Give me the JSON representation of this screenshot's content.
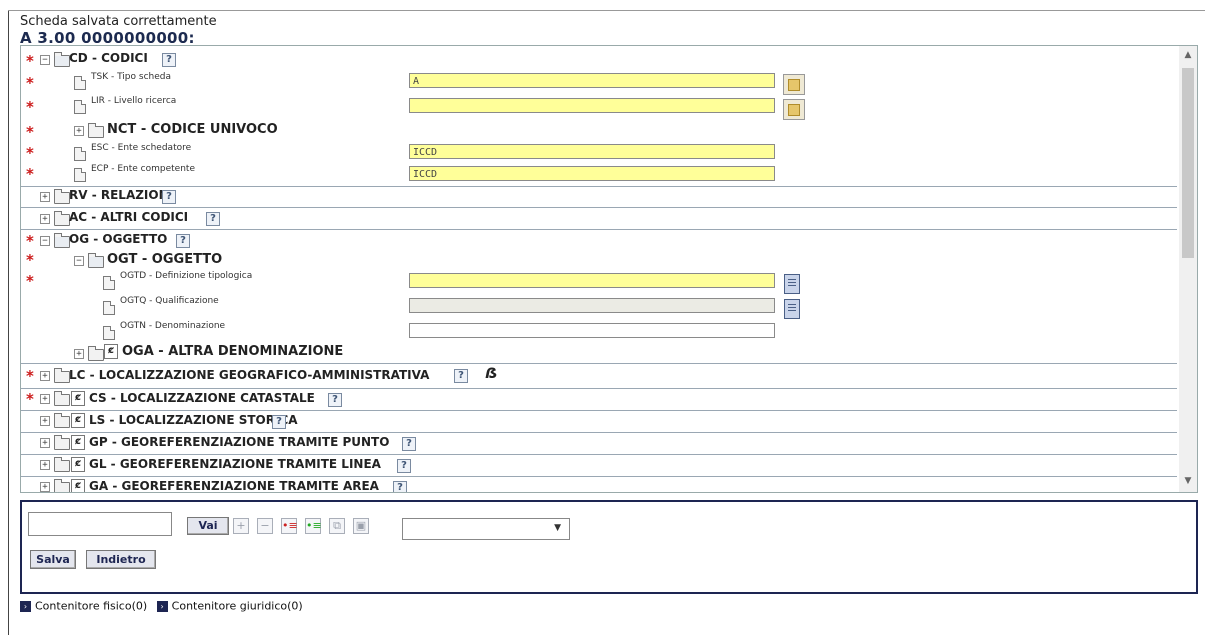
{
  "status_message": "Scheda salvata correttamente",
  "record_heading": "A 3.00 0000000000:",
  "mandatory_mark": "*",
  "help_label": "?",
  "repeat_label": "ȼ",
  "tree": {
    "cd_title": "CD - CODICI",
    "tsk_label": "TSK - Tipo scheda",
    "tsk_value": "A",
    "lir_label": "LIR - Livello ricerca",
    "lir_value": "",
    "nct_title": "NCT - CODICE UNIVOCO",
    "esc_label": "ESC - Ente schedatore",
    "esc_value": "ICCD",
    "ecp_label": "ECP - Ente competente",
    "ecp_value": "ICCD",
    "rv_title": "RV - RELAZIONI",
    "ac_title": "AC - ALTRI CODICI",
    "og_title": "OG - OGGETTO",
    "ogt_title": "OGT - OGGETTO",
    "ogtd_label": "OGTD - Definizione tipologica",
    "ogtq_label": "OGTQ - Qualificazione",
    "ogtn_label": "OGTN - Denominazione",
    "oga_title": "OGA - ALTRA DENOMINAZIONE",
    "lc_title": "LC - LOCALIZZAZIONE GEOGRAFICO-AMMINISTRATIVA",
    "cs_title": "CS - LOCALIZZAZIONE CATASTALE",
    "ls_title": "LS - LOCALIZZAZIONE STORICA",
    "gp_title": "GP - GEOREFERENZIAZIONE TRAMITE PUNTO",
    "gl_title": "GL - GEOREFERENZIAZIONE TRAMITE LINEA",
    "ga_title": "GA - GEOREFERENZIAZIONE TRAMITE AREA"
  },
  "toolbar": {
    "go_label": "Vai",
    "go_input_value": "",
    "add_icon": "+",
    "remove_icon": "−",
    "icon_add_red": "•≡",
    "icon_add_green": "•≡",
    "icon_copy": "⧉",
    "icon_paste": "▣",
    "select_value": ""
  },
  "buttons": {
    "save": "Salva",
    "back": "Indietro"
  },
  "links": {
    "arrow": "›",
    "physical": "Contenitore fisico(0)",
    "legal": "Contenitore giuridico(0)"
  },
  "colors": {
    "mandatory": "#cc1b1b",
    "field_required": "#ffff99",
    "panel_border": "#1d2552"
  }
}
